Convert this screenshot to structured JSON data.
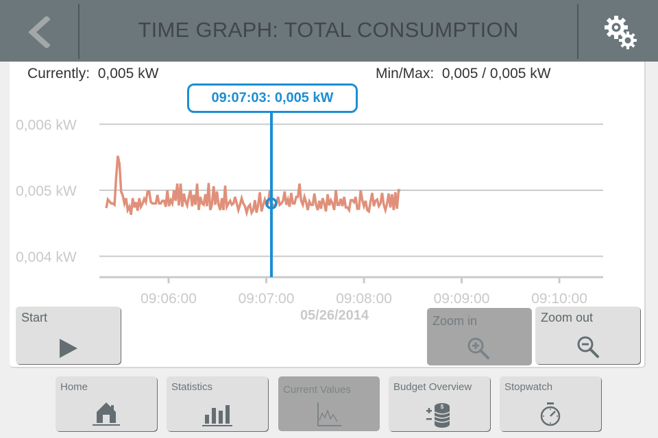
{
  "header": {
    "title": "TIME GRAPH: TOTAL CONSUMPTION",
    "back_icon": "chevron-left-icon",
    "settings_icon": "gears-icon"
  },
  "readouts": {
    "current_label": "Currently:",
    "current_value": "0,005 kW",
    "minmax_label": "Min/Max:",
    "minmax_value": "0,005 / 0,005 kW"
  },
  "cursor": {
    "label": "09:07:03: 0,005 kW",
    "time_sec": 423,
    "value": 0.0048
  },
  "colors": {
    "header_bg": "#6c777c",
    "series": "#e0907a",
    "cursor": "#1b8ed3",
    "grid": "#c8cbcc"
  },
  "date_label": "05/26/2014",
  "controls": {
    "start": {
      "label": "Start",
      "icon": "play-icon"
    },
    "zoom_in": {
      "label": "Zoom in",
      "icon": "zoom-in-icon",
      "active": true
    },
    "zoom_out": {
      "label": "Zoom out",
      "icon": "zoom-out-icon"
    }
  },
  "nav": [
    {
      "label": "Home",
      "icon": "home-icon",
      "active": false
    },
    {
      "label": "Statistics",
      "icon": "bar-chart-icon",
      "active": false
    },
    {
      "label": "Current Values",
      "icon": "line-chart-icon",
      "active": true
    },
    {
      "label": "Budget Overview",
      "icon": "coins-icon",
      "active": false
    },
    {
      "label": "Stopwatch",
      "icon": "stopwatch-icon",
      "active": false
    }
  ],
  "chart_data": {
    "type": "line",
    "title": "",
    "xlabel": "",
    "ylabel": "",
    "x_unit": "seconds after 09:05:00",
    "xlim": [
      -43,
      267
    ],
    "ylim": [
      0.00367,
      0.0062
    ],
    "x_ticks": [
      {
        "t": 60,
        "label": "09:06:00"
      },
      {
        "t": 120,
        "label": "09:07:00"
      },
      {
        "t": 180,
        "label": "09:08:00"
      },
      {
        "t": 240,
        "label": "09:09:00"
      },
      {
        "t": 300,
        "label": "09:10:00"
      }
    ],
    "y_ticks": [
      {
        "v": 0.006,
        "label": "0,006 kW"
      },
      {
        "v": 0.005,
        "label": "0,005 kW"
      },
      {
        "v": 0.004,
        "label": "0,004 kW"
      }
    ],
    "grid": true,
    "legend": "none",
    "series": [
      {
        "name": "Total consumption (kW)",
        "t_start": 26,
        "t_step": 1,
        "values": [
          0.00473,
          0.00486,
          0.00483,
          0.0048,
          0.0048,
          0.00478,
          0.0052,
          0.00552,
          0.0054,
          0.00498,
          0.00492,
          0.0048,
          0.00488,
          0.0047,
          0.00475,
          0.00463,
          0.00488,
          0.00474,
          0.00482,
          0.00469,
          0.00488,
          0.00475,
          0.0048,
          0.00487,
          0.00482,
          0.00498,
          0.00498,
          0.00482,
          0.0048,
          0.0048,
          0.0048,
          0.00493,
          0.0048,
          0.0048,
          0.00484,
          0.00484,
          0.00475,
          0.005,
          0.00476,
          0.00485,
          0.0048,
          0.005,
          0.00484,
          0.0051,
          0.00477,
          0.0051,
          0.00475,
          0.00495,
          0.00483,
          0.00477,
          0.0049,
          0.005,
          0.00476,
          0.00493,
          0.00478,
          0.0051,
          0.0047,
          0.0049,
          0.0048,
          0.00478,
          0.00494,
          0.00476,
          0.00511,
          0.0047,
          0.00478,
          0.00506,
          0.00478,
          0.00498,
          0.00478,
          0.0047,
          0.00488,
          0.0047,
          0.00507,
          0.00475,
          0.0048,
          0.00484,
          0.00478,
          0.0048,
          0.0049,
          0.0048,
          0.0047,
          0.00478,
          0.00488,
          0.0048,
          0.00476,
          0.00466,
          0.00475,
          0.00478,
          0.00466,
          0.0047,
          0.00485,
          0.00466,
          0.00478,
          0.00497,
          0.00468,
          0.00478,
          0.00486,
          0.00478,
          0.0048,
          0.005,
          0.00476,
          0.00478,
          0.00477,
          0.0048,
          0.0049,
          0.00478,
          0.0048,
          0.00484,
          0.00498,
          0.00478,
          0.00486,
          0.00475,
          0.00496,
          0.0048,
          0.0048,
          0.0049,
          0.0049,
          0.0051,
          0.00484,
          0.00478,
          0.0049,
          0.00482,
          0.0047,
          0.00483,
          0.00478,
          0.00478,
          0.00495,
          0.00478,
          0.0047,
          0.00484,
          0.00472,
          0.00488,
          0.0048,
          0.00468,
          0.00494,
          0.00477,
          0.00485,
          0.0048,
          0.0047,
          0.005,
          0.00478,
          0.00478,
          0.00487,
          0.00476,
          0.0049,
          0.00474,
          0.00474,
          0.0047,
          0.00485,
          0.00485,
          0.00482,
          0.0049,
          0.00472,
          0.00472,
          0.005,
          0.00485,
          0.00476,
          0.00484,
          0.0047,
          0.00468,
          0.00483,
          0.00496,
          0.00476,
          0.00484,
          0.00486,
          0.00476,
          0.0048,
          0.00496,
          0.00478,
          0.0047,
          0.0048,
          0.00495,
          0.00474,
          0.00494,
          0.0047,
          0.00497,
          0.00472,
          0.005,
          0.005
        ]
      }
    ]
  }
}
